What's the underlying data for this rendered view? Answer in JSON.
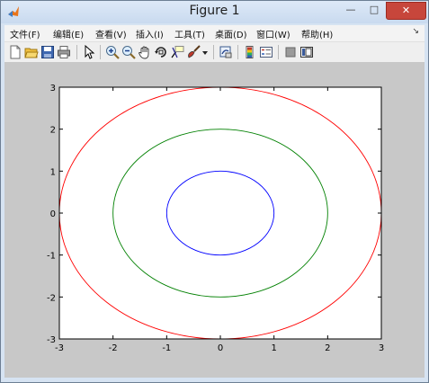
{
  "window": {
    "title": "Figure 1",
    "minimize_glyph": "—",
    "maximize_glyph": "□",
    "close_glyph": "✕",
    "app_icon": "matlab-logo-icon"
  },
  "menu": {
    "items": [
      "文件(F)",
      "编辑(E)",
      "查看(V)",
      "插入(I)",
      "工具(T)",
      "桌面(D)",
      "窗口(W)",
      "帮助(H)"
    ],
    "overflow_glyph": "↘"
  },
  "toolbar": {
    "icons": [
      "new-figure-icon",
      "open-file-icon",
      "save-icon",
      "print-icon",
      "edit-plot-arrow-icon",
      "zoom-in-icon",
      "zoom-out-icon",
      "pan-hand-icon",
      "rotate-3d-icon",
      "data-cursor-icon",
      "brush-icon",
      "brush-dropdown-icon",
      "link-plot-icon",
      "insert-colorbar-icon",
      "insert-legend-icon",
      "hide-plot-tools-icon",
      "show-plot-tools-icon"
    ]
  },
  "colors": {
    "window_frame": "#d6e3f2",
    "figure_background": "#c8c8c8",
    "axes_background": "#ffffff",
    "series_blue": "#0000ff",
    "series_green": "#008000",
    "series_red": "#ff0000"
  },
  "chart_data": {
    "type": "line",
    "title": "",
    "xlabel": "",
    "ylabel": "",
    "xlim": [
      -3,
      3
    ],
    "ylim": [
      -3,
      3
    ],
    "xticks": [
      "-3",
      "-2",
      "-1",
      "0",
      "1",
      "2",
      "3"
    ],
    "yticks": [
      "-3",
      "-2",
      "-1",
      "0",
      "1",
      "2",
      "3"
    ],
    "grid": false,
    "legend": "none",
    "series": [
      {
        "color": "#0000ff",
        "shape": "circle",
        "center": [
          0,
          0
        ],
        "radius": 1
      },
      {
        "color": "#008000",
        "shape": "circle",
        "center": [
          0,
          0
        ],
        "radius": 2
      },
      {
        "color": "#ff0000",
        "shape": "circle",
        "center": [
          0,
          0
        ],
        "radius": 3
      }
    ]
  }
}
